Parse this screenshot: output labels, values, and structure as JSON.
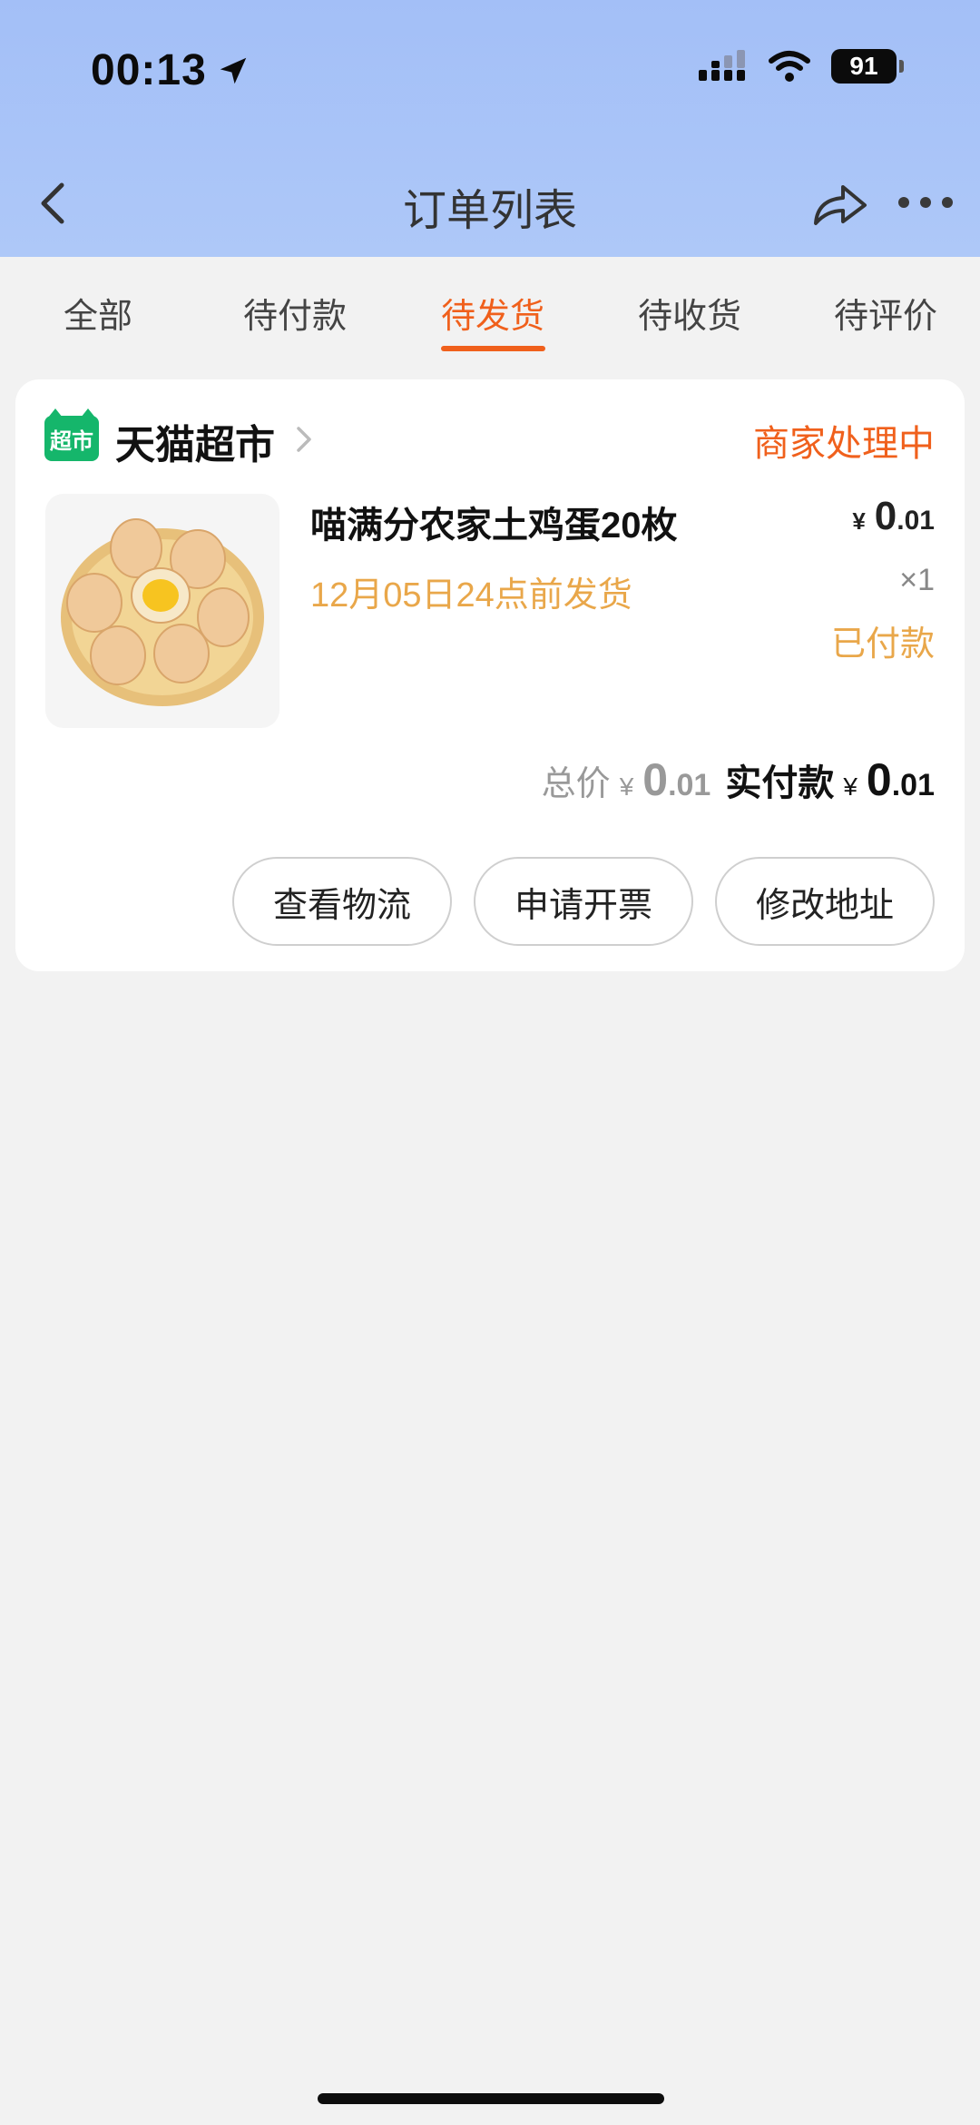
{
  "status_bar": {
    "time": "00:13",
    "battery": "91",
    "icons": [
      "location-arrow-icon",
      "signal-icon",
      "wifi-icon",
      "battery-icon"
    ]
  },
  "nav": {
    "title": "订单列表",
    "icons": [
      "back-chevron-icon",
      "share-icon",
      "more-icon"
    ]
  },
  "tabs": [
    {
      "label": "全部",
      "active": false
    },
    {
      "label": "待付款",
      "active": false
    },
    {
      "label": "待发货",
      "active": true
    },
    {
      "label": "待收货",
      "active": false
    },
    {
      "label": "待评价",
      "active": false
    }
  ],
  "order": {
    "shop": {
      "logo_text": "超市",
      "name": "天猫超市"
    },
    "status": "商家处理中",
    "product": {
      "name": "喵满分农家土鸡蛋20枚",
      "ship_note": "12月05日24点前发货",
      "price_symbol": "¥",
      "price_int": "0",
      "price_dec": ".01",
      "quantity": "×1",
      "paid_label": "已付款"
    },
    "totals": {
      "total_label": "总价",
      "total_symbol": "¥",
      "total_int": "0",
      "total_dec": ".01",
      "paid_label": "实付款",
      "paid_symbol": "¥",
      "paid_int": "0",
      "paid_dec": ".01"
    },
    "actions": [
      {
        "label": "查看物流"
      },
      {
        "label": "申请开票"
      },
      {
        "label": "修改地址"
      }
    ]
  },
  "colors": {
    "accent": "#f0601c",
    "note": "#e9a74a",
    "header_bg": "#a3bff7",
    "shop_green": "#15b66b"
  }
}
